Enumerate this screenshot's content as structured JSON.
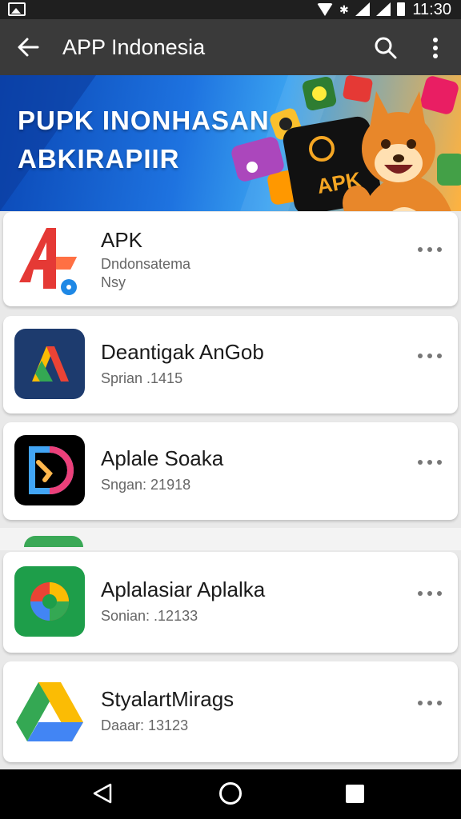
{
  "status_bar": {
    "time": "11:30",
    "icons": [
      "gallery-icon",
      "wifi-icon",
      "bluetooth-icon",
      "signal-icon",
      "battery-icon"
    ]
  },
  "app_bar": {
    "title": "APP Indonesia",
    "back_icon": "arrow-left-icon",
    "search_icon": "search-icon",
    "more_icon": "more-vert-icon",
    "background": "#3a3a3a"
  },
  "banner": {
    "line1": "PUPK INONHASAN",
    "line2": "ABKIRAPIIR",
    "badge_text": "APK"
  },
  "apps": [
    {
      "name": "APK",
      "line1": "Dndonsatema",
      "line2": "Nsy"
    },
    {
      "name": "Deantigak AnGob",
      "line1": "Sprian .1415"
    },
    {
      "name": "Aplale Soaka",
      "line1": "Sngan: 21918"
    },
    {
      "name": "Aplalasiar Aplalka",
      "line1": "Sonian: .12133"
    },
    {
      "name": "StyalartMirags",
      "line1": "Daaar: 13123"
    }
  ],
  "nav_bar": {
    "icons": [
      "nav-back-icon",
      "nav-home-icon",
      "nav-recents-icon"
    ]
  }
}
